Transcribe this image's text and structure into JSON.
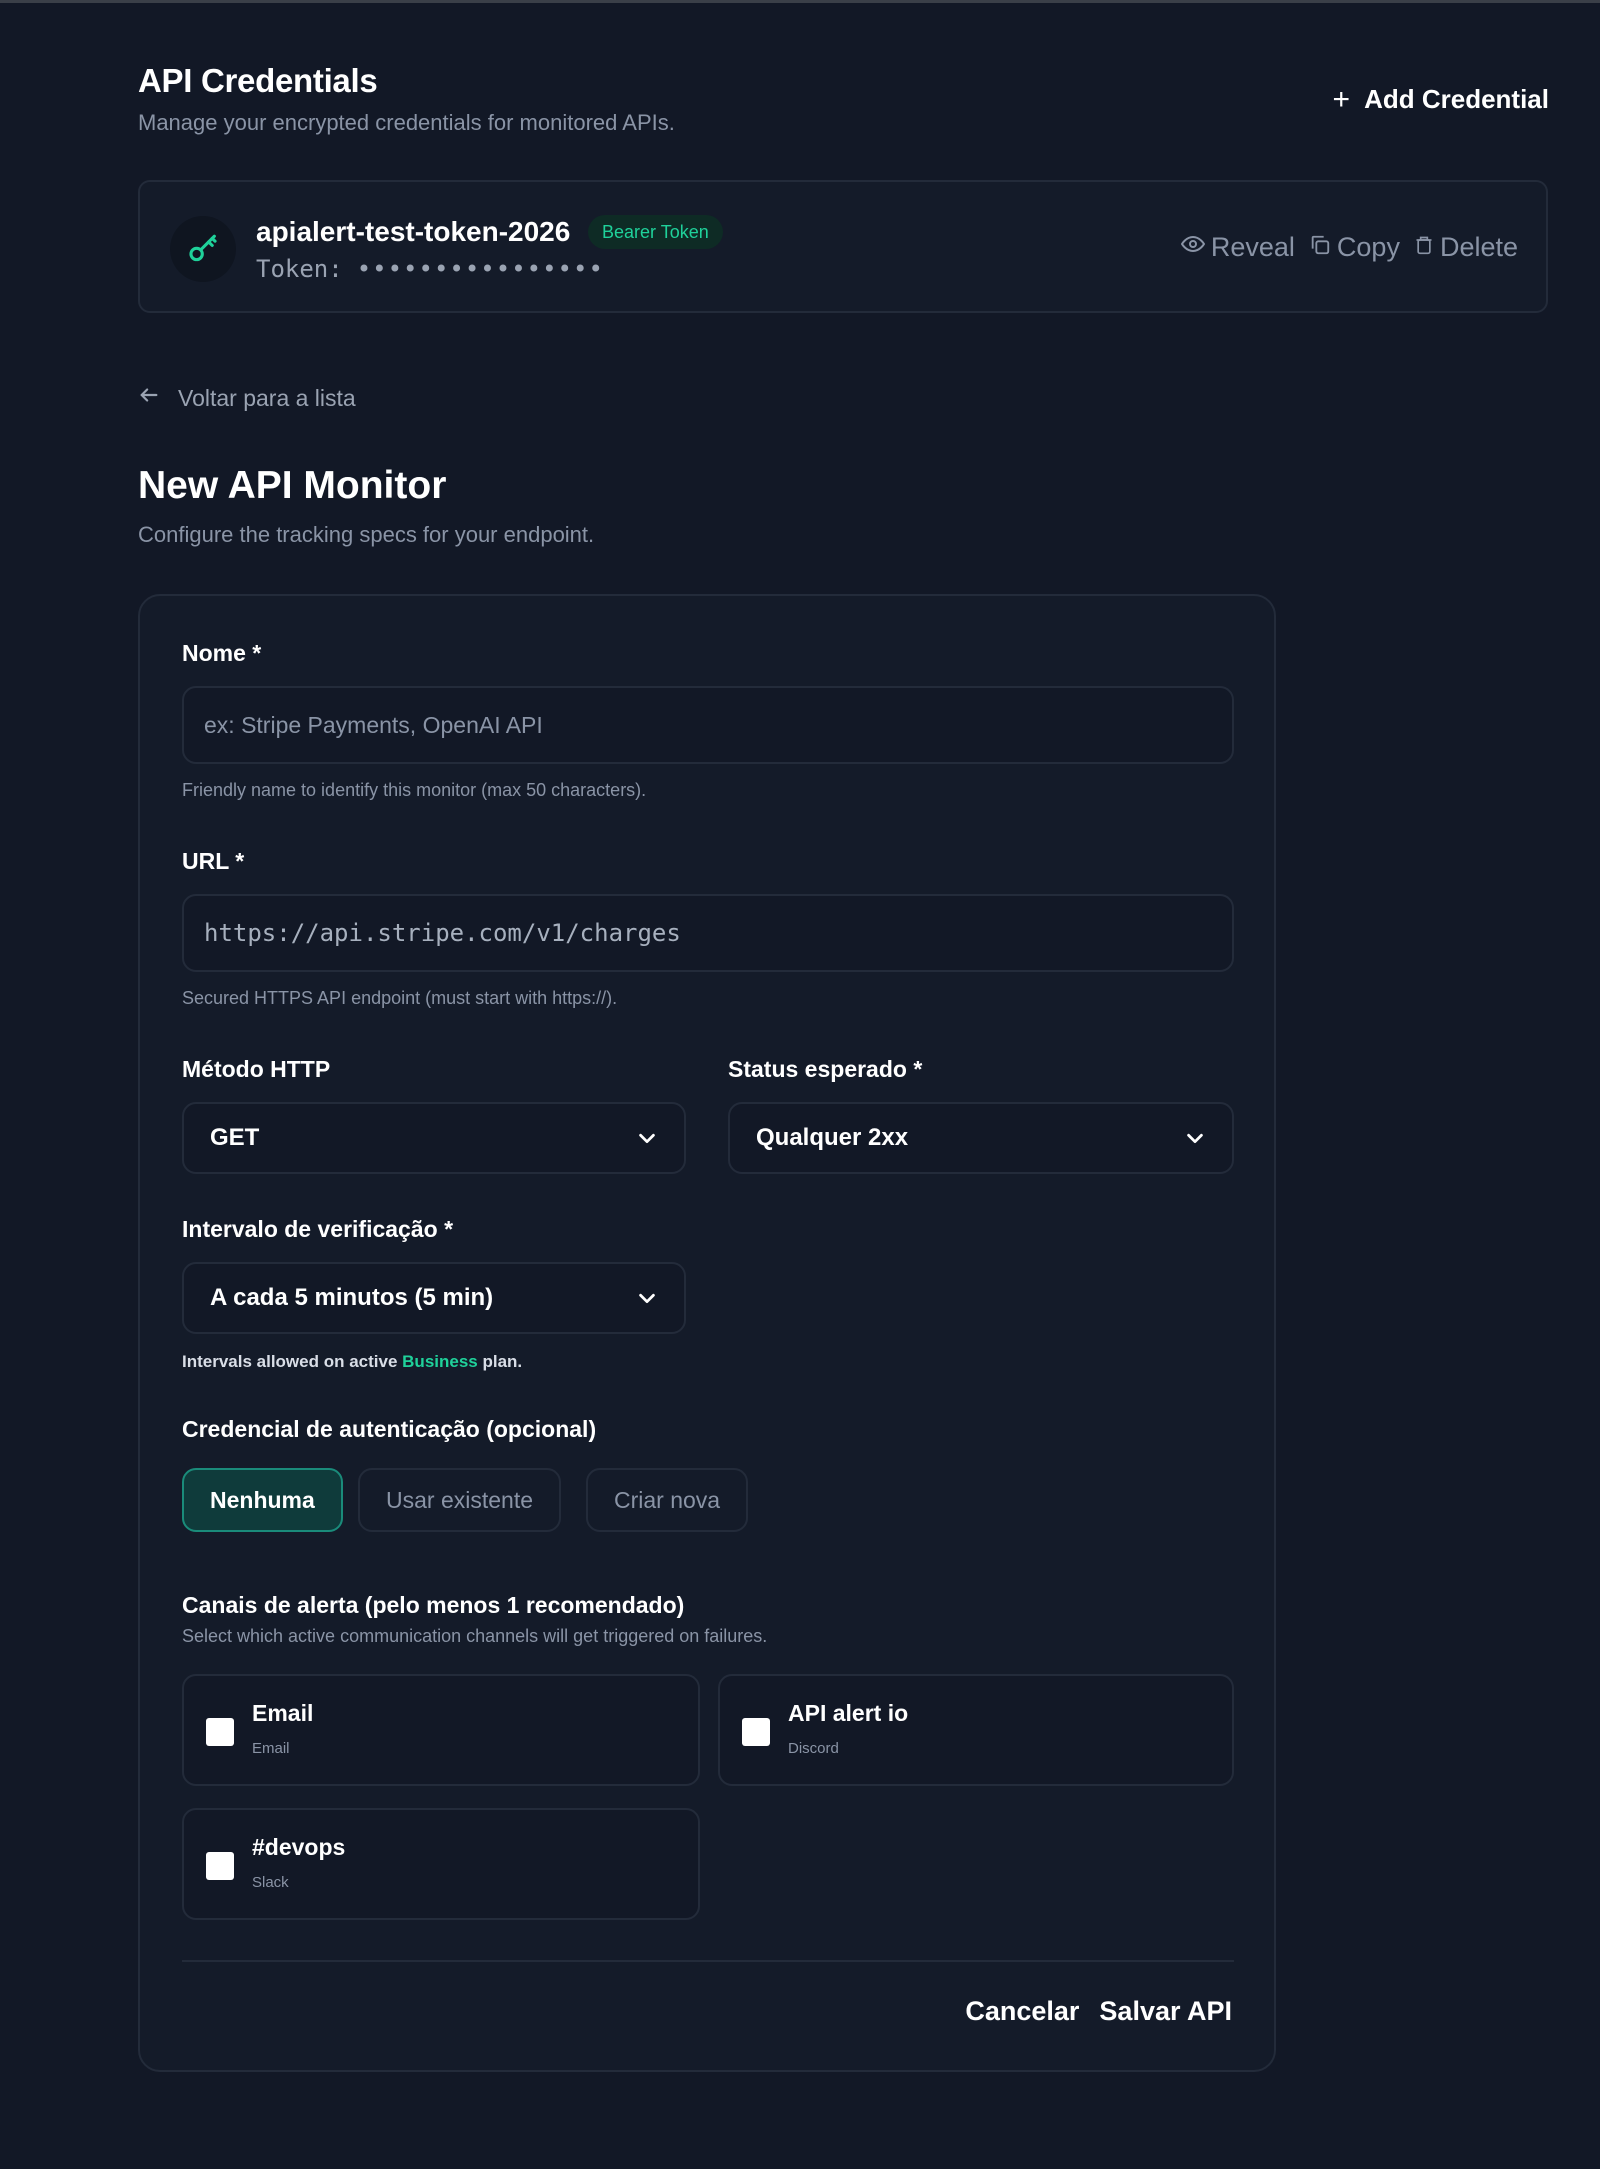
{
  "credentials": {
    "title": "API Credentials",
    "subtitle": "Manage your encrypted credentials for monitored APIs.",
    "add_label": "Add Credential",
    "items": [
      {
        "name": "apialert-test-token-2026",
        "badge": "Bearer Token",
        "token_label": "Token:",
        "token_mask": "••••••••••••••••",
        "actions": {
          "reveal": "Reveal",
          "copy": "Copy",
          "delete": "Delete"
        }
      }
    ]
  },
  "back_link": "Voltar para a lista",
  "monitor": {
    "title": "New API Monitor",
    "subtitle": "Configure the tracking specs for your endpoint."
  },
  "form": {
    "name": {
      "label": "Nome *",
      "placeholder": "ex: Stripe Payments, OpenAI API",
      "help": "Friendly name to identify this monitor (max 50 characters)."
    },
    "url": {
      "label": "URL *",
      "placeholder": "https://api.stripe.com/v1/charges",
      "help": "Secured HTTPS API endpoint (must start with https://)."
    },
    "method": {
      "label": "Método HTTP",
      "value": "GET"
    },
    "status": {
      "label": "Status esperado *",
      "value": "Qualquer 2xx"
    },
    "interval": {
      "label": "Intervalo de verificação *",
      "value": "A cada 5 minutos (5 min)",
      "note_prefix": "Intervals allowed on active",
      "note_plan": "Business",
      "note_suffix": "plan."
    },
    "auth": {
      "label": "Credencial de autenticação (opcional)",
      "options": [
        "Nenhuma",
        "Usar existente",
        "Criar nova"
      ],
      "selected": "Nenhuma"
    },
    "channels": {
      "label": "Canais de alerta (pelo menos 1 recomendado)",
      "help": "Select which active communication channels will get triggered on failures.",
      "items": [
        {
          "name": "Email",
          "type": "Email",
          "checked": false
        },
        {
          "name": "API alert io",
          "type": "Discord",
          "checked": false
        },
        {
          "name": "#devops",
          "type": "Slack",
          "checked": false
        }
      ]
    },
    "cancel_label": "Cancelar",
    "save_label": "Salvar API"
  },
  "colors": {
    "background": "#121826",
    "card": "#141b29",
    "accent": "#1fd19a",
    "active_segment": "#0f3b3b"
  }
}
